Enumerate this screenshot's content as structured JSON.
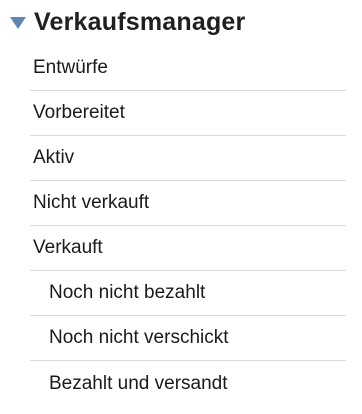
{
  "header": {
    "title": "Verkaufsmanager",
    "toggle_icon": "triangle-down-icon",
    "toggle_color": "#5f87b6"
  },
  "menu": {
    "items": [
      {
        "label": "Entwürfe"
      },
      {
        "label": "Vorbereitet"
      },
      {
        "label": "Aktiv"
      },
      {
        "label": "Nicht verkauft"
      },
      {
        "label": "Verkauft"
      },
      {
        "label": "Noch nicht bezahlt"
      },
      {
        "label": "Noch nicht verschickt"
      },
      {
        "label": "Bezahlt und versandt"
      }
    ]
  }
}
